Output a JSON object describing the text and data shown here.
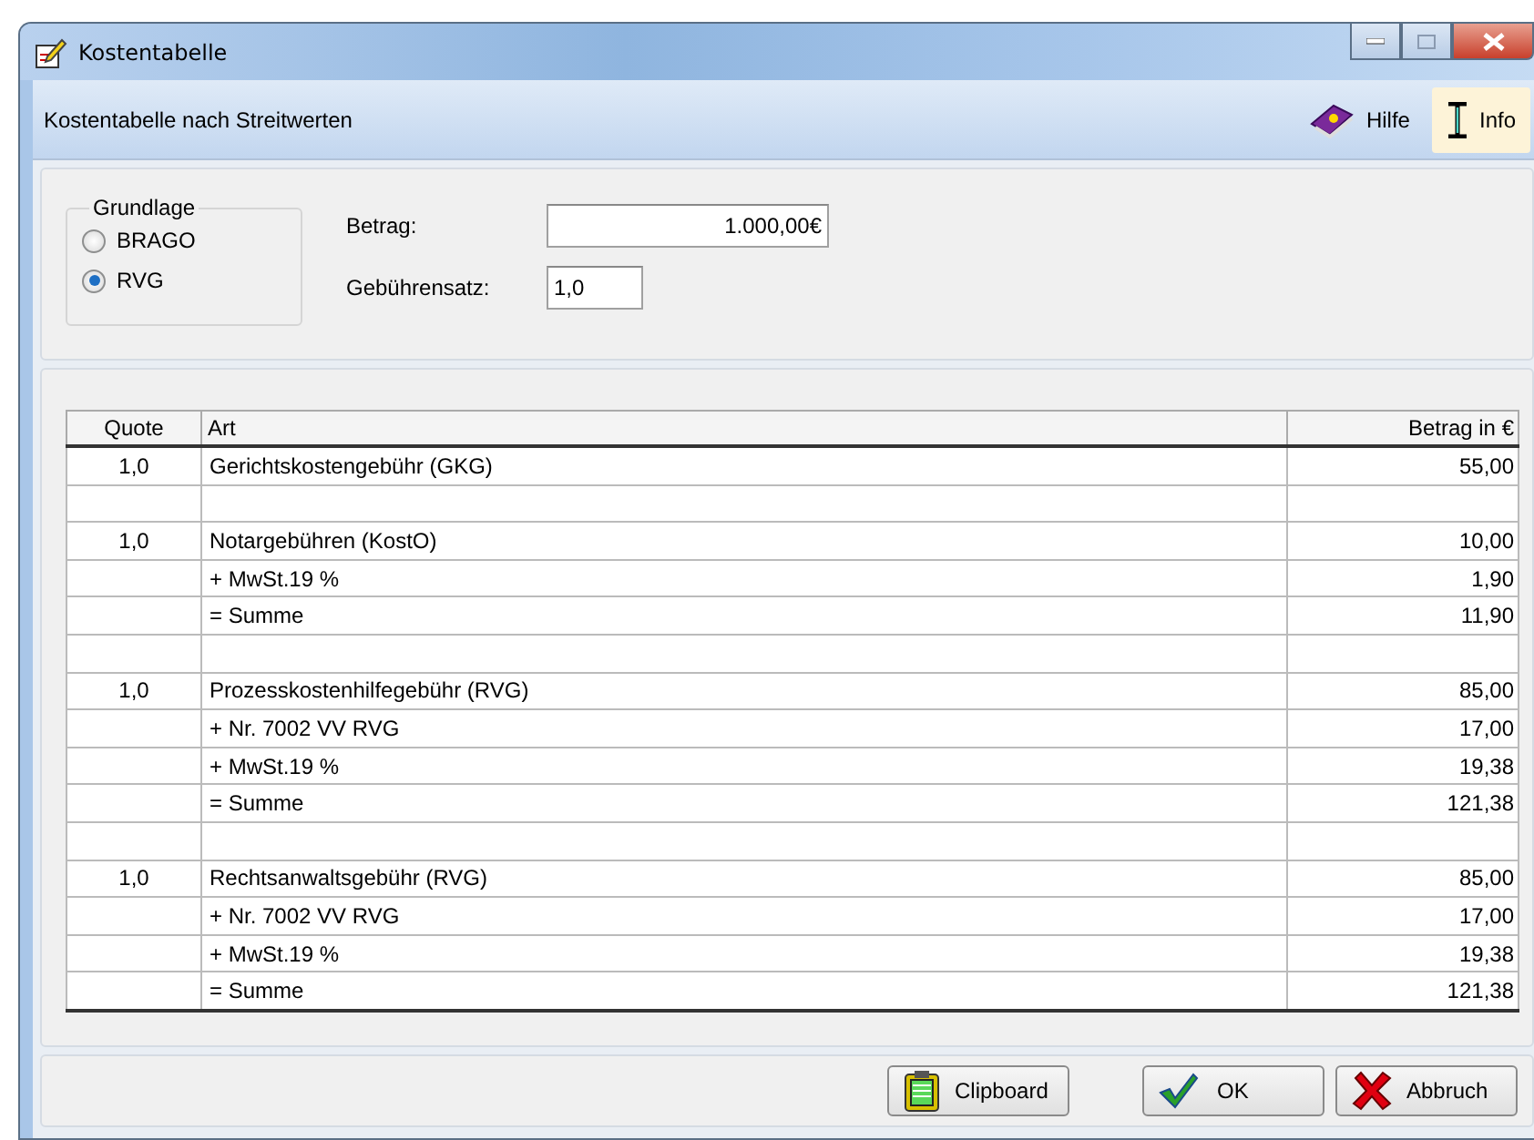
{
  "window": {
    "title": "Kostentabelle"
  },
  "toolbar": {
    "caption": "Kostentabelle nach Streitwerten",
    "buttons": [
      {
        "label": "Hilfe",
        "kind": "help",
        "selected": false
      },
      {
        "label": "Info",
        "kind": "info",
        "selected": true
      }
    ]
  },
  "grundlage": {
    "title": "Grundlage",
    "options": [
      {
        "label": "BRAGO",
        "selected": false
      },
      {
        "label": "RVG",
        "selected": true
      }
    ]
  },
  "fields": [
    {
      "label": "Betrag:",
      "value": "1.000,00€",
      "kind": "wide"
    },
    {
      "label": "Gebührensatz:",
      "value": "1,0",
      "kind": "narrow"
    }
  ],
  "table": {
    "columns": [
      "Quote",
      "Art",
      "Betrag in €"
    ],
    "rows": [
      {
        "kind": "entry",
        "quote": "1,0",
        "art": "Gerichtskostengebühr (GKG)",
        "betrag": "55,00"
      },
      {
        "kind": "spacer"
      },
      {
        "kind": "entry",
        "quote": "1,0",
        "art": "Notargebühren (KostO)",
        "betrag": "10,00"
      },
      {
        "kind": "entry",
        "art": "+ MwSt.19 %",
        "betrag": "1,90"
      },
      {
        "kind": "entry",
        "art": "= Summe",
        "betrag": "11,90"
      },
      {
        "kind": "spacer"
      },
      {
        "kind": "entry",
        "quote": "1,0",
        "art": "Prozesskostenhilfegebühr (RVG)",
        "betrag": "85,00"
      },
      {
        "kind": "entry",
        "art": "+ Nr. 7002 VV RVG",
        "betrag": "17,00"
      },
      {
        "kind": "entry",
        "art": "+ MwSt.19 %",
        "betrag": "19,38"
      },
      {
        "kind": "entry",
        "art": "= Summe",
        "betrag": "121,38"
      },
      {
        "kind": "spacer"
      },
      {
        "kind": "entry",
        "quote": "1,0",
        "art": "Rechtsanwaltsgebühr (RVG)",
        "betrag": "85,00"
      },
      {
        "kind": "entry",
        "art": "+ Nr. 7002 VV RVG",
        "betrag": "17,00"
      },
      {
        "kind": "entry",
        "art": "+ MwSt.19 %",
        "betrag": "19,38"
      },
      {
        "kind": "entry",
        "art": "= Summe",
        "betrag": "121,38"
      }
    ]
  },
  "buttons": [
    {
      "label": "Clipboard",
      "kind": "clipboard"
    },
    {
      "label": "OK",
      "kind": "ok"
    },
    {
      "label": "Abbruch",
      "kind": "cancel"
    }
  ]
}
